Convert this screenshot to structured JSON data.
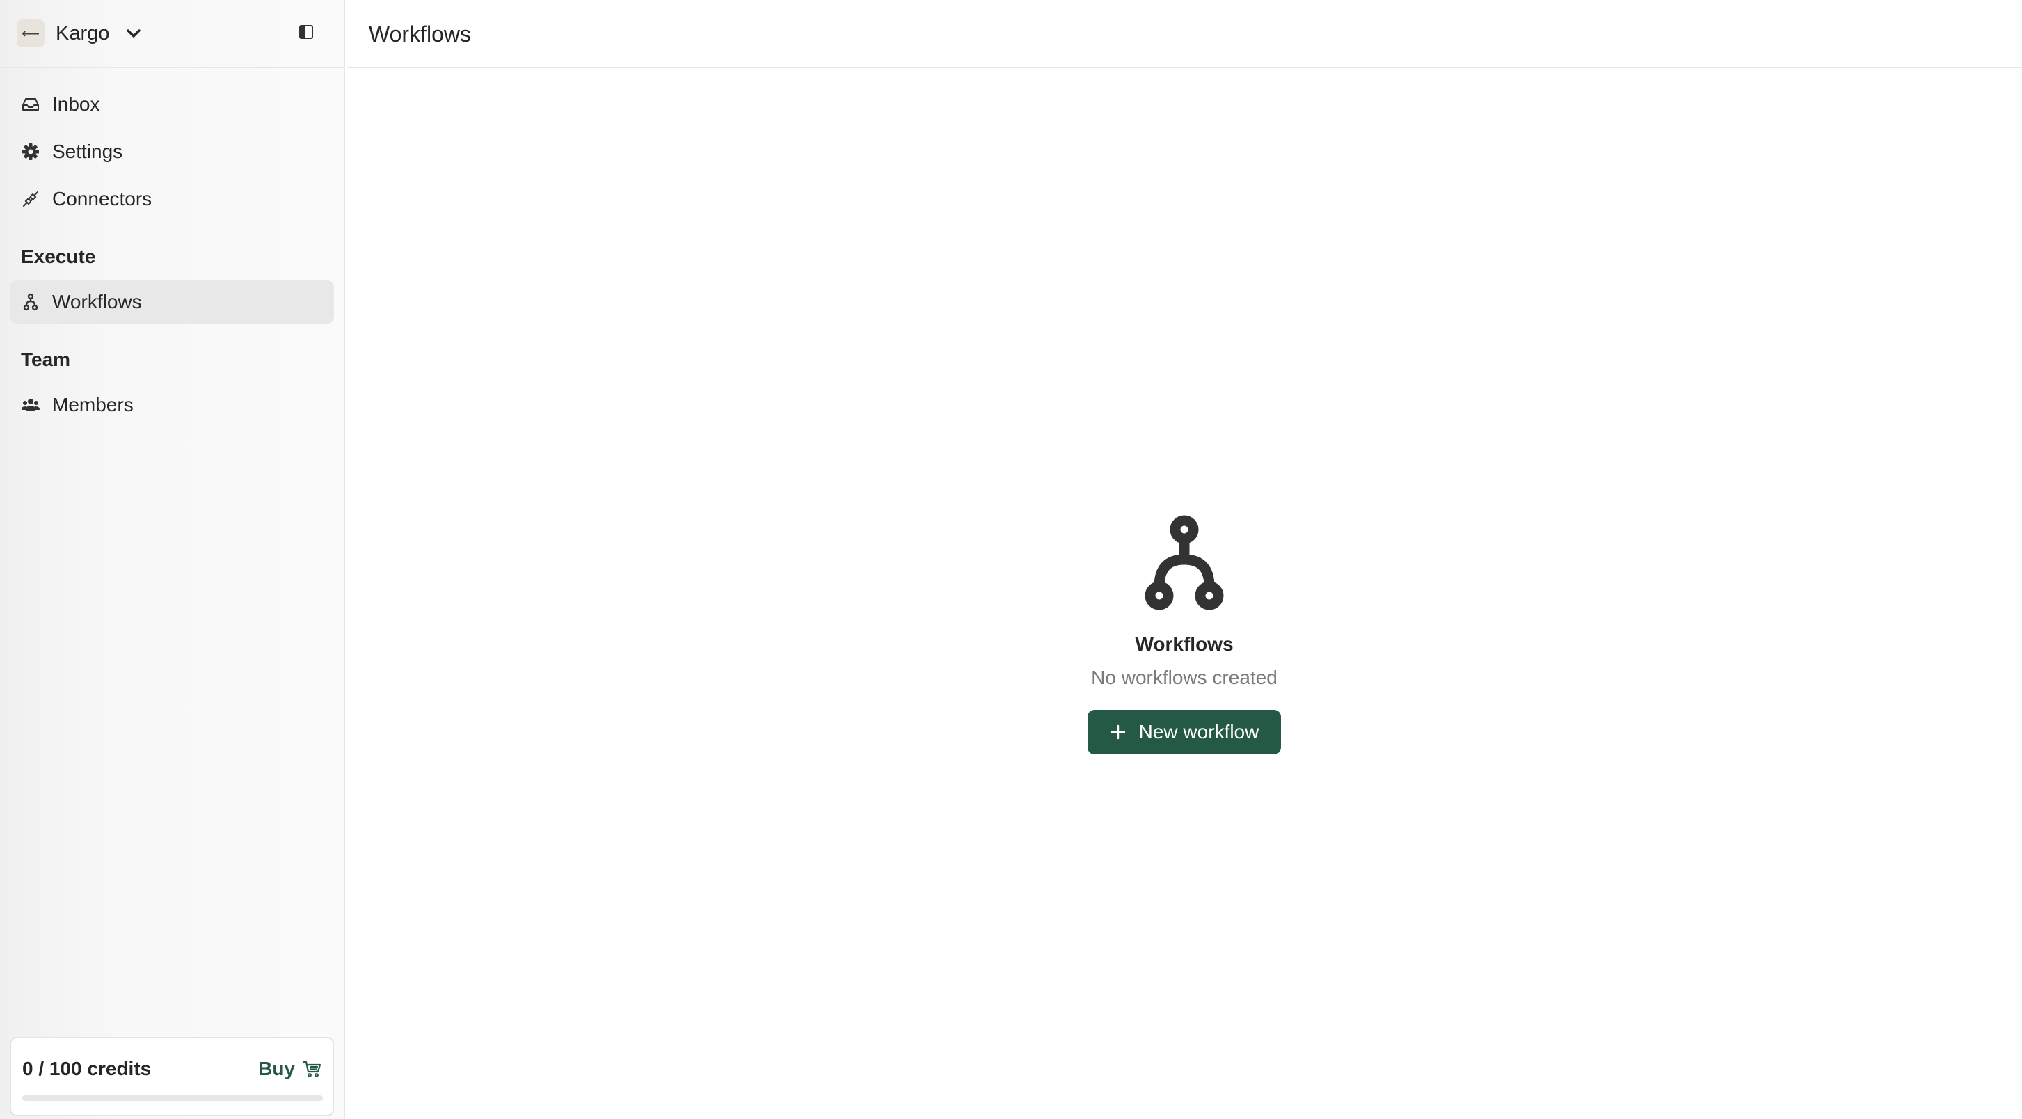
{
  "workspace": {
    "avatar_glyph": "⟵",
    "name": "Kargo",
    "chevron_icon": "chevron-down-icon",
    "collapse_icon": "sidebar-collapse-icon"
  },
  "nav": {
    "items": [
      {
        "id": "inbox",
        "label": "Inbox",
        "icon": "inbox-icon"
      },
      {
        "id": "settings",
        "label": "Settings",
        "icon": "gear-icon"
      },
      {
        "id": "connectors",
        "label": "Connectors",
        "icon": "plug-icon"
      }
    ],
    "sections": [
      {
        "title": "Execute",
        "items": [
          {
            "id": "workflows",
            "label": "Workflows",
            "icon": "workflow-icon",
            "active": true
          }
        ]
      },
      {
        "title": "Team",
        "items": [
          {
            "id": "members",
            "label": "Members",
            "icon": "users-icon"
          }
        ]
      }
    ]
  },
  "credits": {
    "label": "0 / 100 credits",
    "used": 0,
    "total": 100,
    "progress_fraction": 0,
    "buy_label": "Buy",
    "buy_icon": "cart-icon"
  },
  "header": {
    "title": "Workflows"
  },
  "empty_state": {
    "icon": "workflow-icon",
    "title": "Workflows",
    "subtitle": "No workflows created",
    "button_label": "New workflow",
    "button_icon": "plus-icon"
  },
  "colors": {
    "accent": "#245a45",
    "sidebar_bg": "#f8f8f8",
    "active_item_bg": "#e8e8e8",
    "text_primary": "#262626",
    "text_muted": "#7a7a7a",
    "border": "#e6e6e6"
  }
}
